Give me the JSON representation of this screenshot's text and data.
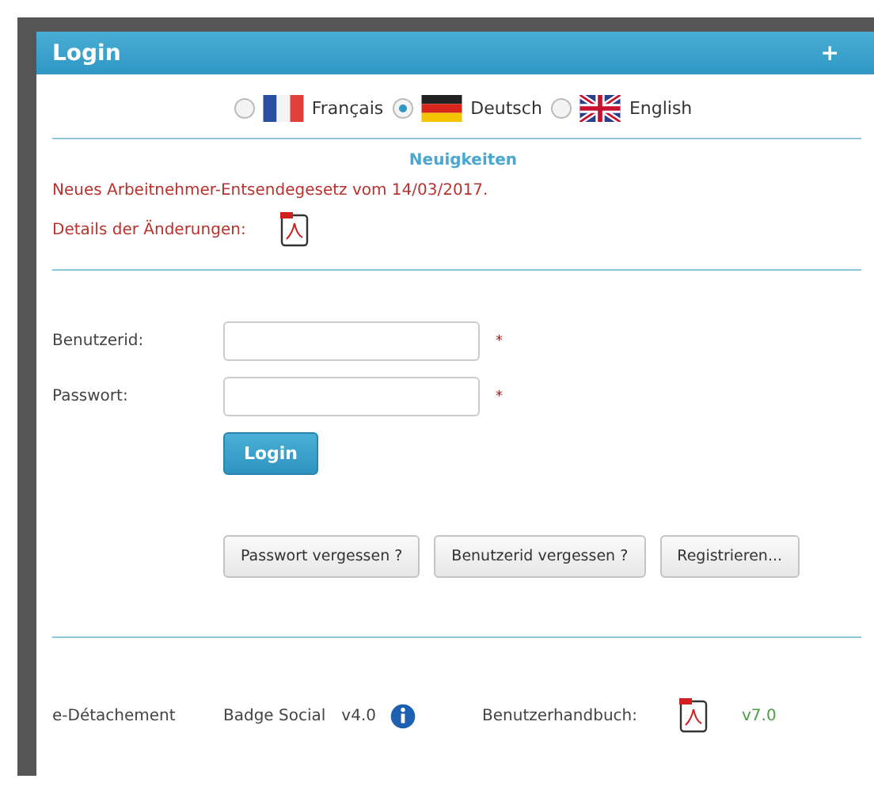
{
  "panel": {
    "title": "Login",
    "expand_symbol": "+"
  },
  "languages": [
    {
      "label": "Français",
      "kind": "france",
      "selected": false
    },
    {
      "label": "Deutsch",
      "kind": "germany",
      "selected": true
    },
    {
      "label": "English",
      "kind": "britain",
      "selected": false
    }
  ],
  "news": {
    "heading": "Neuigkeiten",
    "text": "Neues Arbeitnehmer-Entsendegesetz vom 14/03/2017.",
    "details_label": "Details der Änderungen:"
  },
  "form": {
    "fields": [
      {
        "label": "Benutzerid:",
        "required_mark": "*"
      },
      {
        "label": "Passwort:",
        "required_mark": "*"
      }
    ],
    "submit": "Login"
  },
  "buttons": [
    "Passwort vergessen ?",
    "Benutzerid vergessen ?",
    "Registrieren..."
  ],
  "footer": {
    "app": "e-Détachement",
    "badge": "Badge Social",
    "version": "v4.0",
    "manual_label": "Benutzerhandbuch:",
    "manual_version": "v7.0"
  }
}
